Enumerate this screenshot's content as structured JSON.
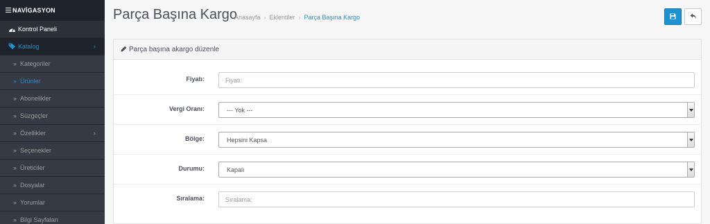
{
  "sidebar": {
    "heading": "NAVİGASYON",
    "items": [
      {
        "label": "Kontrol Paneli",
        "icon": "dashboard-icon"
      },
      {
        "label": "Katalog",
        "icon": "tags-icon"
      },
      {
        "label": "Kategoriler"
      },
      {
        "label": "Ürünler"
      },
      {
        "label": "Abonelikler"
      },
      {
        "label": "Süzgeçler"
      },
      {
        "label": "Özellikler"
      },
      {
        "label": "Seçenekler"
      },
      {
        "label": "Üreticiler"
      },
      {
        "label": "Dosyalar"
      },
      {
        "label": "Yorumlar"
      },
      {
        "label": "Bilgi Sayfaları"
      }
    ]
  },
  "header": {
    "title": "Parça Başına Kargo",
    "breadcrumb": [
      "Anasayfa",
      "Eklentiler",
      "Parça Başına Kargo"
    ],
    "save_icon": "save-icon",
    "back_icon": "reply-icon"
  },
  "panel": {
    "heading": "Parça başına akargo düzenle",
    "fields": {
      "price": {
        "label": "Fiyatı:",
        "value": "",
        "placeholder": "Fiyatı:"
      },
      "tax": {
        "label": "Vergi Oranı:",
        "selected": "--- Yok ---"
      },
      "zone": {
        "label": "Bölge:",
        "selected": "Hepsini Kapsa"
      },
      "status": {
        "label": "Durumu:",
        "selected": "Kapalı"
      },
      "sort": {
        "label": "Sıralama:",
        "value": "",
        "placeholder": "Sıralama:"
      }
    }
  },
  "colors": {
    "accent": "#1e91cf",
    "sidebar_bg": "#2b3039",
    "sidebar_sub_bg": "#353a44"
  }
}
